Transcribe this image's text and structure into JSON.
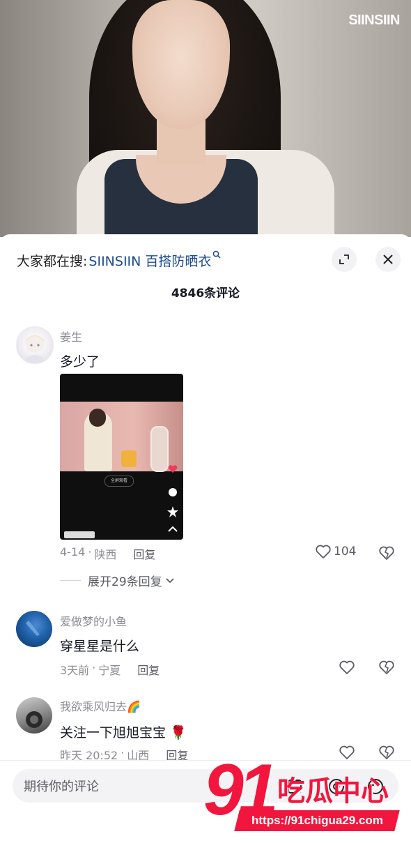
{
  "video": {
    "brand_logo": "SIINSIIN"
  },
  "sheet": {
    "search_prefix": "大家都在搜:",
    "search_term": "SIINSIIN 百搭防晒衣",
    "search_icon": "search-icon",
    "comment_count": "4846条评论"
  },
  "comments": [
    {
      "name": "姜生",
      "text": "多少了",
      "date": "4-14",
      "location": "陕西",
      "reply_label": "回复",
      "likes": "104",
      "thumb_chip": "全屏观看",
      "expand_label": "展开29条回复"
    },
    {
      "name": "爱做梦的小鱼",
      "text": "穿星星是什么",
      "date": "3天前",
      "location": "宁夏",
      "reply_label": "回复"
    },
    {
      "name": "我欲乘风归去🌈",
      "text": "关注一下旭旭宝宝 🌹",
      "date": "昨天 20:52",
      "location": "山西",
      "reply_label": "回复"
    }
  ],
  "input": {
    "placeholder": "期待你的评论"
  },
  "watermark": {
    "number": "91",
    "name": "吃瓜中心",
    "url": "https://91chigua29.com"
  },
  "colors": {
    "link_blue": "#1c4a8c",
    "text_gray": "#8a8b91",
    "watermark_red": "#f2163e"
  }
}
